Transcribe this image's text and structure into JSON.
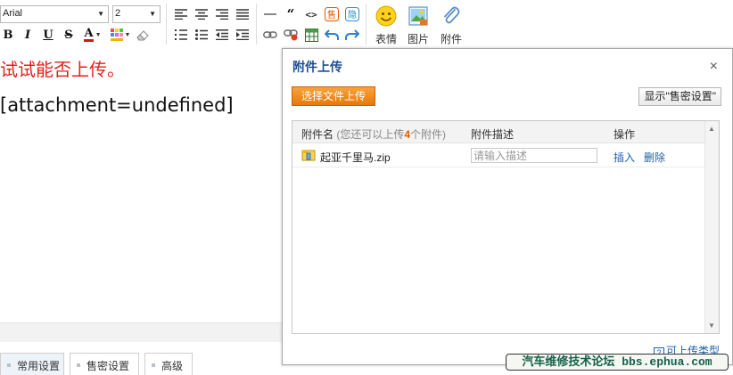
{
  "toolbar": {
    "font_name": "Arial",
    "font_size": "2",
    "bold_glyph": "B",
    "italic_glyph": "I",
    "underline_glyph": "U",
    "strike_glyph": "S",
    "color_glyph": "A",
    "quote_glyph": "“",
    "code_glyph": "<>",
    "smiley_label": "表情",
    "image_label": "图片",
    "attach_label": "附件",
    "accent_color": "#e05a00"
  },
  "editor": {
    "line1": "试试能否上传。",
    "line2": "[attachment=undefined]",
    "line1_color": "#e81e1e"
  },
  "bottom_tabs": [
    "常用设置",
    "售密设置",
    "高级"
  ],
  "dialog": {
    "title": "附件上传",
    "close": "×",
    "upload_button": "选择文件上传",
    "toggle_button": "显示\"售密设置\"",
    "columns": {
      "name": "附件名",
      "note_before": "(您还可以上传",
      "remaining": "4",
      "note_after": "个附件)",
      "desc": "附件描述",
      "ops": "操作"
    },
    "files": [
      {
        "name": "起亚千里马.zip",
        "desc_placeholder": "请输入描述",
        "insert": "插入",
        "delete": "删除"
      }
    ],
    "upload_types": "可上传类型",
    "help_glyph": "?"
  },
  "watermark": "汽车维修技术论坛 bbs.ephua.com"
}
